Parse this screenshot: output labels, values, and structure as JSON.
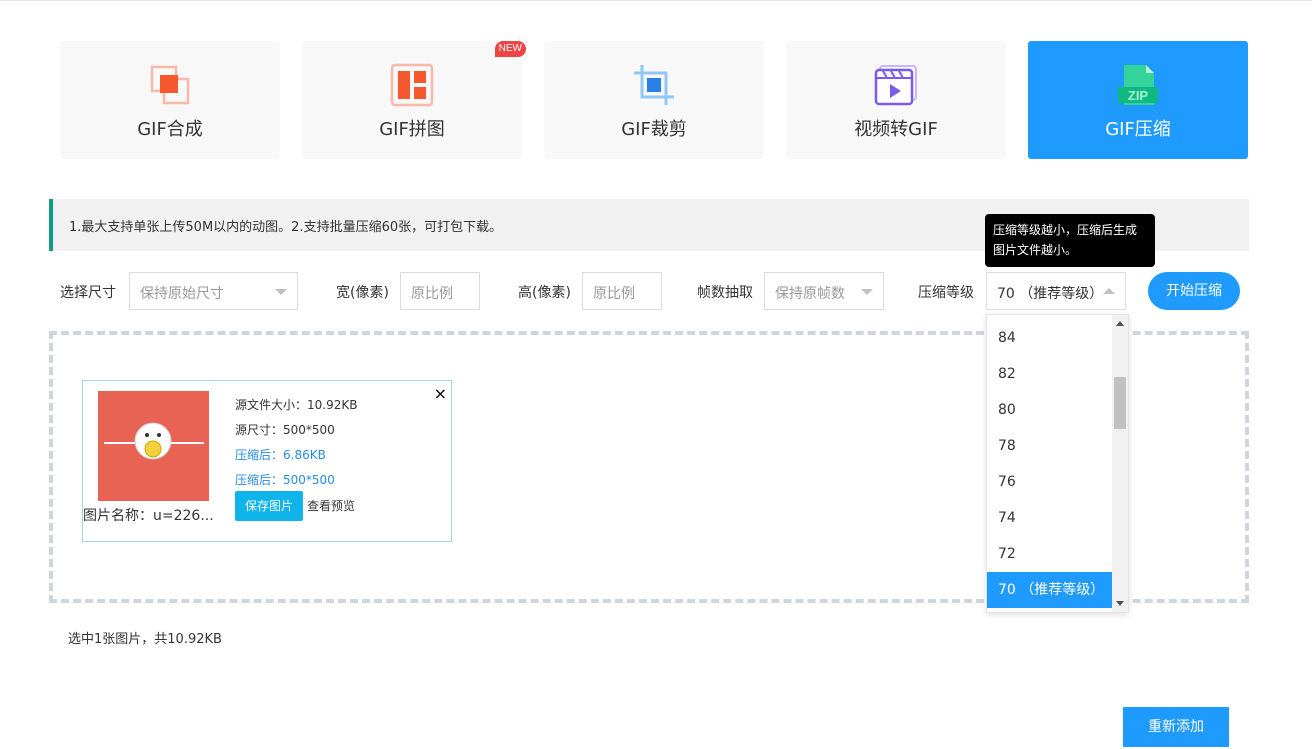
{
  "tabs": [
    {
      "label": "GIF合成",
      "icon": "gif-merge-icon"
    },
    {
      "label": "GIF拼图",
      "icon": "gif-collage-icon",
      "badge": "NEW"
    },
    {
      "label": "GIF裁剪",
      "icon": "crop-icon"
    },
    {
      "label": "视频转GIF",
      "icon": "video-icon"
    },
    {
      "label": "GIF压缩",
      "icon": "zip-icon",
      "active": true
    }
  ],
  "notice": "1.最大支持单张上传50M以内的动图。2.支持批量压缩60张，可打包下载。",
  "tooltip": {
    "line1": "压缩等级越小，压缩后生成",
    "line2": "图片文件越小。"
  },
  "options": {
    "size_label": "选择尺寸",
    "size_value": "保持原始尺寸",
    "width_label": "宽(像素)",
    "width_placeholder": "原比例",
    "height_label": "高(像素)",
    "height_placeholder": "原比例",
    "frame_label": "帧数抽取",
    "frame_value": "保持原帧数",
    "level_label": "压缩等级",
    "level_value": "70 （推荐等级）",
    "start_button": "开始压缩"
  },
  "dropdown": {
    "items": [
      "84",
      "82",
      "80",
      "78",
      "76",
      "74",
      "72",
      "70 （推荐等级）"
    ],
    "selected_index": 7
  },
  "file": {
    "src_size": "源文件大小：10.92KB",
    "src_dim": "源尺寸：500*500",
    "comp_size": "压缩后：6.86KB",
    "comp_dim": "压缩后：500*500",
    "name": "图片名称：u=226...",
    "save_button": "保存图片",
    "preview_link": "查看预览",
    "close": "×"
  },
  "summary": "选中1张图片，共10.92KB",
  "readd_button": "重新添加",
  "colors": {
    "accent": "#1f9bff",
    "notice_bar": "#0e9e86",
    "thumb_bg": "#e96354",
    "save_btn": "#0fb4ea"
  }
}
